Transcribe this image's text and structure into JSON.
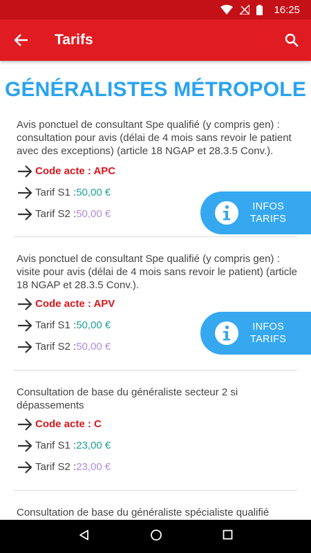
{
  "status_bar": {
    "time": "16:25"
  },
  "app_bar": {
    "title": "Tarifs"
  },
  "page_title": "GÉNÉRALISTES MÉTROPOLE",
  "infos_button": {
    "line1": "INFOS",
    "line2": "TARIFS"
  },
  "tariffs": [
    {
      "description": "Avis ponctuel de consultant Spe qualifié (y compris gen) : consultation pour avis (délai de 4 mois sans revoir le patient avec des exceptions) (article 18 NGAP et 28.3.5 Conv.).",
      "code_label": "Code acte : APC",
      "s1_label": "Tarif S1 : ",
      "s1_value": "50,00 €",
      "s2_label": "Tarif S2 : ",
      "s2_value": "50,00 €"
    },
    {
      "description": "Avis ponctuel de consultant Spe qualifié (y compris gen) : visite pour avis (délai de 4 mois sans revoir le patient) (article 18 NGAP et 28.3.5 Conv.).",
      "code_label": "Code acte : APV",
      "s1_label": "Tarif S1 : ",
      "s1_value": "50,00 €",
      "s2_label": "Tarif S2 : ",
      "s2_value": "50,00 €"
    },
    {
      "description": "Consultation de base du généraliste secteur 2 si dépassements",
      "code_label": "Code acte : C",
      "s1_label": "Tarif S1 : ",
      "s1_value": "23,00 €",
      "s2_label": "Tarif S2 : ",
      "s2_value": "23,00 €"
    },
    {
      "description": "Consultation de base du généraliste spécialiste qualifié"
    }
  ],
  "colors": {
    "app_bar": "#e01b22",
    "status_bar": "#c41118",
    "title_blue": "#29a3ef",
    "code_red": "#d8161d",
    "s1_teal": "#1fa09a",
    "s2_purple": "#b28be0",
    "info_button": "#35a8f0"
  }
}
